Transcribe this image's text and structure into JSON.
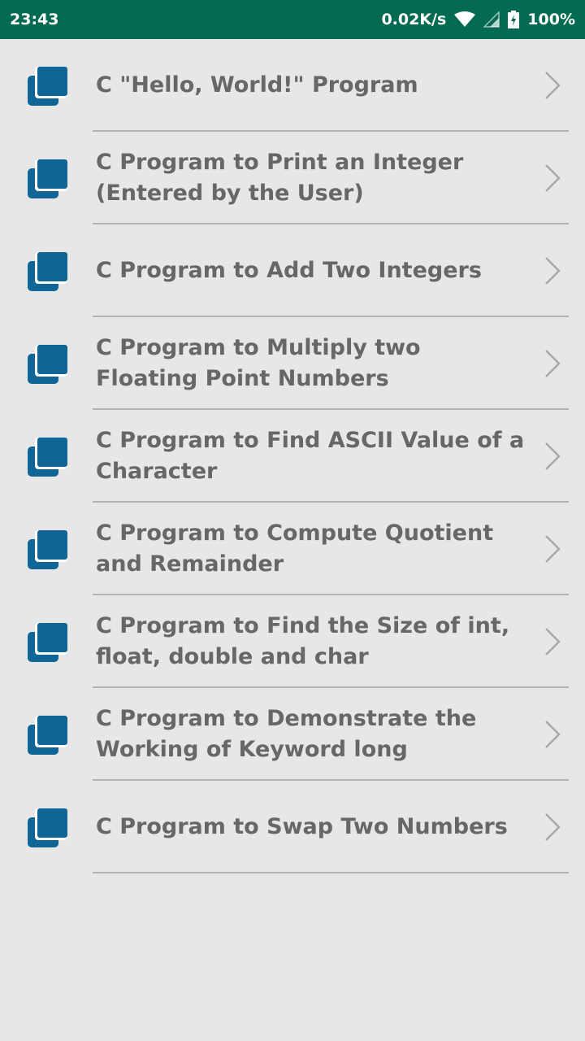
{
  "status_bar": {
    "time": "23:43",
    "net_speed": "0.02K/s",
    "battery": "100%",
    "bg_color": "#036a52"
  },
  "list": {
    "icon": "stacked-squares-icon",
    "icon_color": "#0f6596",
    "items": [
      {
        "label": "C \"Hello, World!\" Program"
      },
      {
        "label": "C Program to Print an Integer (Entered by the User)"
      },
      {
        "label": "C Program to Add Two Integers"
      },
      {
        "label": "C Program to Multiply two Floating Point Numbers"
      },
      {
        "label": "C Program to Find ASCII Value of a Character"
      },
      {
        "label": "C Program to Compute Quotient and Remainder"
      },
      {
        "label": "C Program to Find the Size of int, float, double and char"
      },
      {
        "label": "C Program to Demonstrate the Working of Keyword long"
      },
      {
        "label": "C Program to Swap Two Numbers"
      }
    ]
  }
}
